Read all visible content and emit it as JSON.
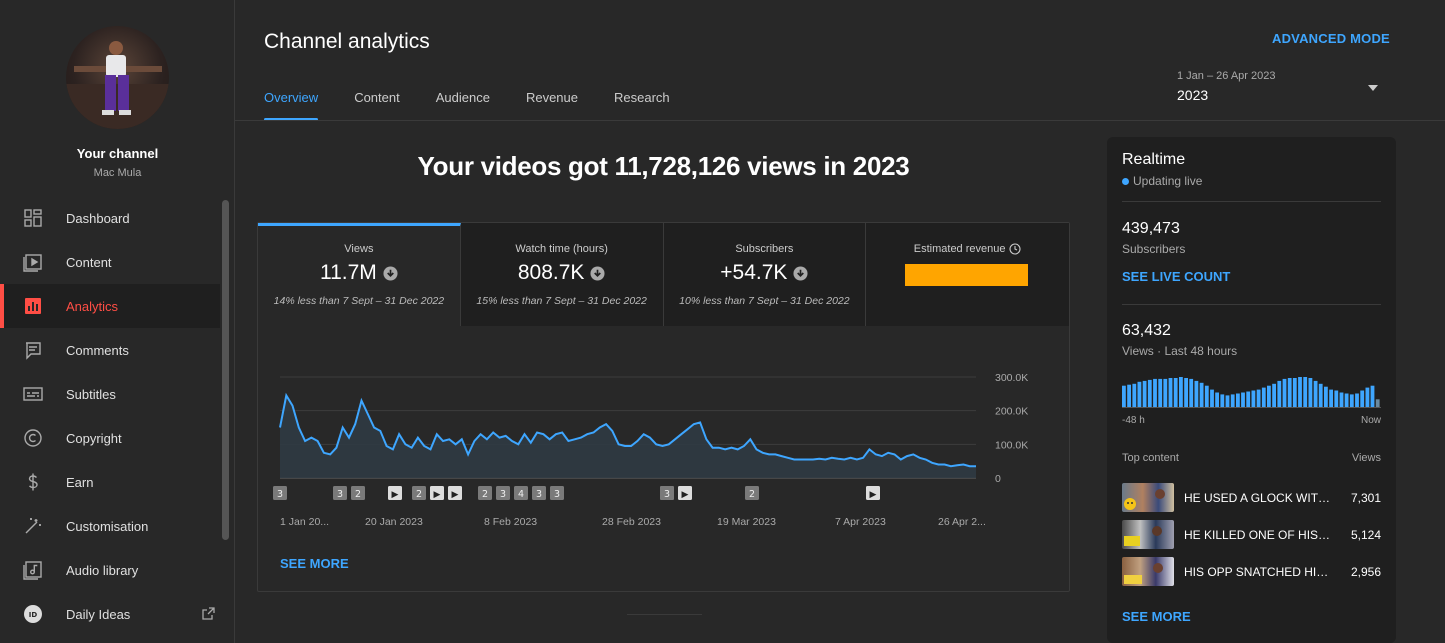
{
  "channel": {
    "title": "Your channel",
    "name": "Mac Mula"
  },
  "sidebar": {
    "items": [
      {
        "label": "Dashboard",
        "icon": "dashboard-icon"
      },
      {
        "label": "Content",
        "icon": "content-icon"
      },
      {
        "label": "Analytics",
        "icon": "analytics-icon",
        "active": true
      },
      {
        "label": "Comments",
        "icon": "comments-icon"
      },
      {
        "label": "Subtitles",
        "icon": "subtitles-icon"
      },
      {
        "label": "Copyright",
        "icon": "copyright-icon"
      },
      {
        "label": "Earn",
        "icon": "earn-icon"
      },
      {
        "label": "Customisation",
        "icon": "customisation-icon"
      },
      {
        "label": "Audio library",
        "icon": "audio-library-icon"
      },
      {
        "label": "Daily Ideas",
        "icon": "daily-ideas-icon",
        "external": true
      }
    ]
  },
  "header": {
    "title": "Channel analytics",
    "advanced_mode": "ADVANCED MODE",
    "tabs": [
      "Overview",
      "Content",
      "Audience",
      "Revenue",
      "Research"
    ],
    "active_tab": "Overview",
    "date_range": "1 Jan – 26 Apr 2023",
    "date_selected": "2023"
  },
  "main": {
    "headline": "Your videos got 11,728,126 views in 2023",
    "metrics": [
      {
        "label": "Views",
        "value": "11.7M",
        "comparison": "14% less than 7 Sept – 31 Dec 2022"
      },
      {
        "label": "Watch time (hours)",
        "value": "808.7K",
        "comparison": "15% less than 7 Sept – 31 Dec 2022"
      },
      {
        "label": "Subscribers",
        "value": "+54.7K",
        "comparison": "10% less than 7 Sept – 31 Dec 2022"
      },
      {
        "label": "Estimated revenue",
        "value": "",
        "comparison": ""
      }
    ],
    "see_more": "SEE MORE"
  },
  "chart_data": {
    "type": "area",
    "series": [
      {
        "values": [
          150,
          245,
          215,
          150,
          110,
          120,
          110,
          75,
          70,
          90,
          150,
          120,
          160,
          230,
          190,
          150,
          140,
          95,
          85,
          130,
          100,
          90,
          120,
          95,
          85,
          130,
          110,
          115,
          100,
          115,
          70,
          110,
          130,
          115,
          135,
          120,
          125,
          110,
          100,
          130,
          105,
          135,
          130,
          115,
          130,
          135,
          110,
          115,
          120,
          130,
          135,
          150,
          160,
          140,
          100,
          95,
          95,
          110,
          130,
          120,
          100,
          95,
          100,
          115,
          130,
          145,
          160,
          165,
          115,
          90,
          90,
          85,
          90,
          85,
          95,
          115,
          85,
          75,
          70,
          70,
          65,
          60,
          55,
          55,
          55,
          55,
          57,
          55,
          60,
          57,
          55,
          60,
          55,
          60,
          85,
          70,
          65,
          75,
          70,
          55,
          65,
          70,
          60,
          55,
          45,
          40,
          40,
          35,
          38,
          40,
          35,
          35
        ]
      }
    ],
    "x_tick_labels": [
      "1 Jan 20...",
      "20 Jan 2023",
      "8 Feb 2023",
      "28 Feb 2023",
      "19 Mar 2023",
      "7 Apr 2023",
      "26 Apr 2..."
    ],
    "y_tick_labels": [
      "300.0K",
      "200.0K",
      "100.0K",
      "0"
    ],
    "ylim": [
      0,
      300000
    ],
    "markers": [
      {
        "label": "3"
      },
      {
        "label": "3"
      },
      {
        "label": "2"
      },
      {
        "label": "▶"
      },
      {
        "label": "2"
      },
      {
        "label": "▶"
      },
      {
        "label": "▶"
      },
      {
        "label": "2"
      },
      {
        "label": "3"
      },
      {
        "label": "4"
      },
      {
        "label": "3"
      },
      {
        "label": "3"
      },
      {
        "label": "3"
      },
      {
        "label": "3"
      },
      {
        "label": "▶"
      },
      {
        "label": "2"
      },
      {
        "label": "▶"
      }
    ],
    "grid": true,
    "color": "#3ea6ff"
  },
  "realtime": {
    "title": "Realtime",
    "status": "Updating live",
    "subscribers_value": "439,473",
    "subscribers_label": "Subscribers",
    "see_live_count": "SEE LIVE COUNT",
    "views_value": "63,432",
    "views_label": "Views · Last 48 hours",
    "axis_start": "-48 h",
    "axis_end": "Now",
    "hourly_views": [
      22,
      23,
      24,
      26,
      27,
      28,
      29,
      29,
      29,
      30,
      30,
      31,
      30,
      29,
      27,
      25,
      22,
      18,
      15,
      13,
      12,
      13,
      14,
      15,
      16,
      17,
      18,
      20,
      22,
      24,
      27,
      29,
      30,
      30,
      31,
      31,
      30,
      27,
      24,
      21,
      18,
      17,
      15,
      14,
      13,
      14,
      17,
      20,
      22,
      8
    ],
    "top_content_label": "Top content",
    "views_col": "Views",
    "top_content": [
      {
        "title": "HE USED A GLOCK WITH ...",
        "views": "7,301"
      },
      {
        "title": "HE KILLED ONE OF HIS O...",
        "views": "5,124"
      },
      {
        "title": "HIS OPP SNATCHED HIS ...",
        "views": "2,956"
      }
    ],
    "see_more": "SEE MORE"
  }
}
